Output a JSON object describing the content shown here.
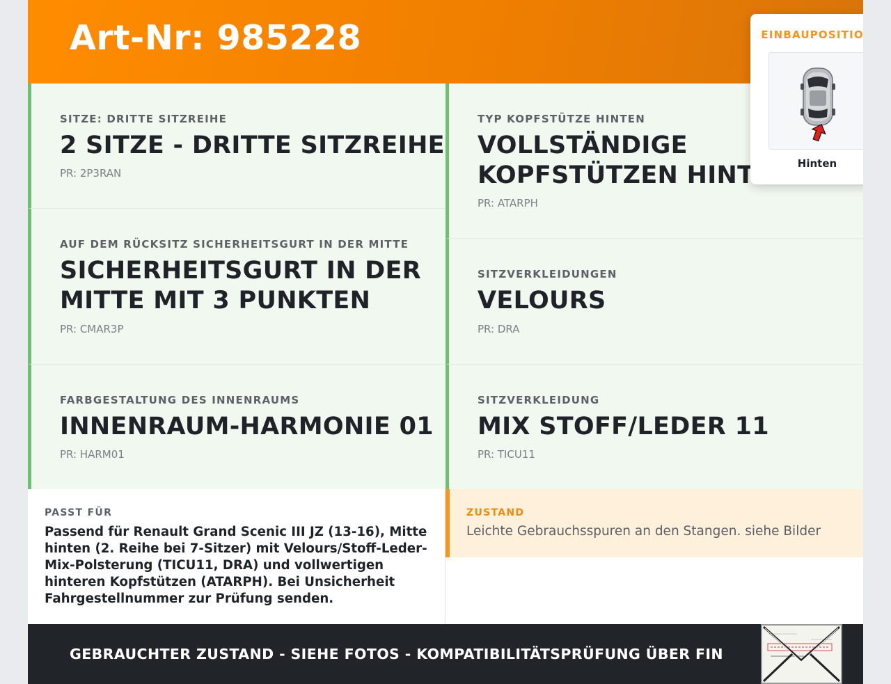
{
  "header": {
    "title": "Art-Nr: 985228"
  },
  "specs": [
    {
      "label": "Sitze: Dritte Sitzreihe",
      "value_lines": [
        "2 SITZE - DRITTE SITZREIHE"
      ],
      "pr": "PR: 2P3RAN"
    },
    {
      "label": "Typ Kopfstütze hinten",
      "value_lines": [
        "VOLLSTÄNDIGE",
        "KOPFSTÜTZEN HINTEN"
      ],
      "pr": "PR: ATARPH"
    },
    {
      "label": "Auf dem Rücksitz Sicherheitsgurt in der Mitte",
      "value_lines": [
        "SICHERHEITSGURT IN DER",
        "MITTE MIT 3 PUNKTEN"
      ],
      "pr": "PR: CMAR3P"
    },
    {
      "label": "Sitzverkleidungen",
      "value_lines": [
        "VELOURS"
      ],
      "pr": "PR: DRA"
    },
    {
      "label": "Farbgestaltung des Innenraums",
      "value_lines": [
        "INNENRAUM-HARMONIE 01"
      ],
      "pr": "PR: HARM01"
    },
    {
      "label": "Sitzverkleidung",
      "value_lines": [
        "MIX STOFF/LEDER 11"
      ],
      "pr": "PR: TICU11"
    }
  ],
  "fits": {
    "label": "PASST FÜR",
    "text": "Passend für Renault Grand Scenic III JZ (13-16), Mitte hinten (2. Reihe bei 7-Sitzer) mit Velours/Stoff-Leder-Mix-Polsterung (TICU11, DRA) und vollwertigen hinteren Kopfstützen (ATARPH). Bei Unsicherheit Fahrgestellnummer zur Prüfung senden."
  },
  "condition": {
    "label": "ZUSTAND",
    "text": "Leichte Gebrauchsspuren an den Stangen. siehe Bilder"
  },
  "footer": {
    "text": "GEBRAUCHTER ZUSTAND - SIEHE FOTOS - KOMPATIBILITÄTSPRÜFUNG ÜBER FIN"
  },
  "position": {
    "label": "EINBAUPOSITION",
    "caption": "Hinten"
  },
  "colors": {
    "header_orange": "#ff8c00",
    "accent_green": "#6cc070",
    "cell_background": "#f1f8f0",
    "condition_background": "#fff0dc",
    "footer_dark": "#212429"
  },
  "icons": {
    "car": "car-top-view-icon",
    "arrow": "rear-arrow-icon",
    "vin": "vin-envelope-icon"
  }
}
